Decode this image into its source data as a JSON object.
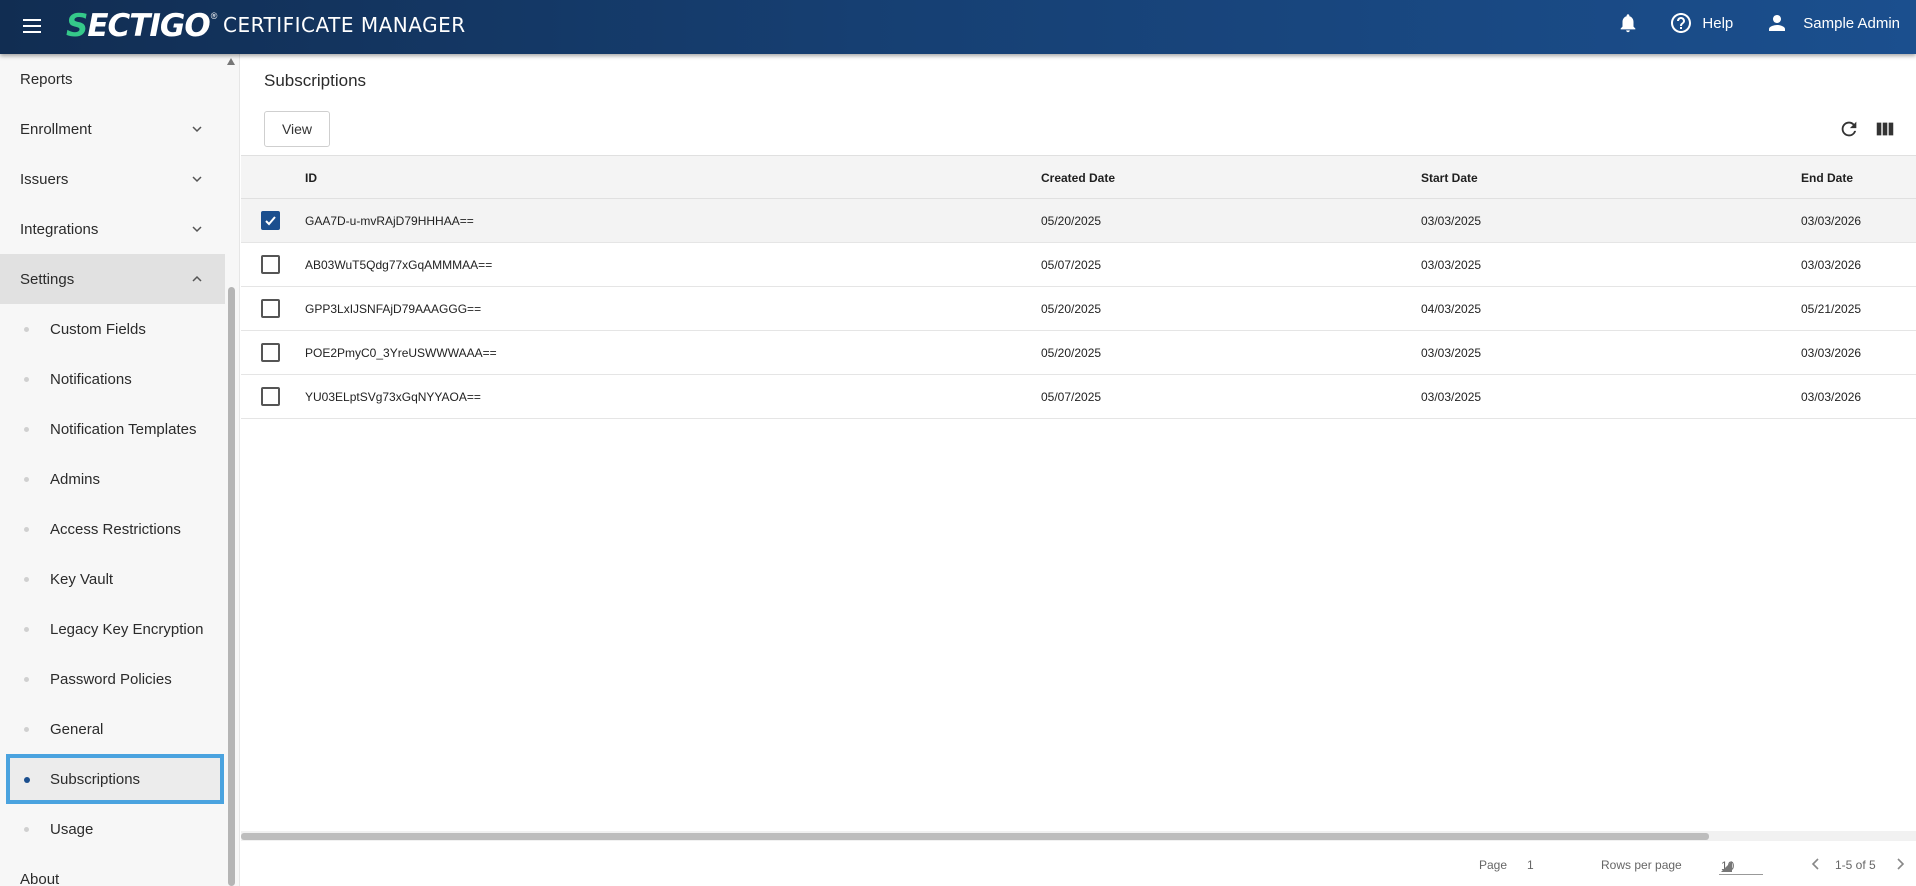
{
  "header": {
    "logo_text_a": "S",
    "logo_text_b": "ECTIGO",
    "logo_reg": "®",
    "app_title": "CERTIFICATE MANAGER",
    "help_label": "Help",
    "user_label": "Sample Admin"
  },
  "sidebar": {
    "items": [
      {
        "label": "Reports"
      },
      {
        "label": "Enrollment"
      },
      {
        "label": "Issuers"
      },
      {
        "label": "Integrations"
      },
      {
        "label": "Settings"
      }
    ],
    "settings_children": [
      {
        "label": "Custom Fields"
      },
      {
        "label": "Notifications"
      },
      {
        "label": "Notification Templates"
      },
      {
        "label": "Admins"
      },
      {
        "label": "Access Restrictions"
      },
      {
        "label": "Key Vault"
      },
      {
        "label": "Legacy Key Encryption"
      },
      {
        "label": "Password Policies"
      },
      {
        "label": "General"
      },
      {
        "label": "Subscriptions"
      },
      {
        "label": "Usage"
      }
    ],
    "about_label": "About",
    "active_item": "Subscriptions"
  },
  "main": {
    "page_title": "Subscriptions",
    "view_button": "View",
    "table": {
      "columns": [
        "ID",
        "Created Date",
        "Start Date",
        "End Date"
      ],
      "rows": [
        {
          "id": "GAA7D-u-mvRAjD79HHHAA==",
          "created": "05/20/2025",
          "start": "03/03/2025",
          "end": "03/03/2026",
          "checked": true
        },
        {
          "id": "AB03WuT5Qdg77xGqAMMMAA==",
          "created": "05/07/2025",
          "start": "03/03/2025",
          "end": "03/03/2026",
          "checked": false
        },
        {
          "id": "GPP3LxIJSNFAjD79AAAGGG==",
          "created": "05/20/2025",
          "start": "04/03/2025",
          "end": "05/21/2025",
          "checked": false
        },
        {
          "id": "POE2PmyC0_3YreUSWWWAAA==",
          "created": "05/20/2025",
          "start": "03/03/2025",
          "end": "03/03/2026",
          "checked": false
        },
        {
          "id": "YU03ELptSVg73xGqNYYAOA==",
          "created": "05/07/2025",
          "start": "03/03/2025",
          "end": "03/03/2026",
          "checked": false
        }
      ]
    },
    "pager": {
      "page_label": "Page",
      "page_value": "1",
      "rows_label": "Rows per page",
      "rows_value": "10",
      "range": "1-5 of 5"
    }
  },
  "colors": {
    "header_start": "#112d52",
    "header_end": "#1b4f8e",
    "brand_green": "#35c98a",
    "selection_outline": "#4aa3df"
  }
}
